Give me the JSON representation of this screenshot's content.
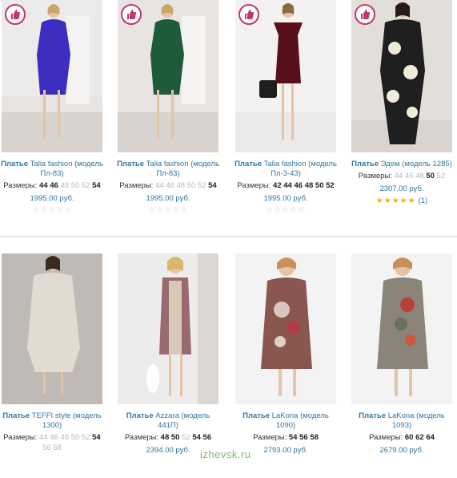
{
  "products": [
    {
      "title_prefix": "Платье",
      "title_rest": "Talia fashion (модель Пл-83)",
      "sizes_label": "Размеры:",
      "sizes": [
        {
          "s": "44",
          "on": true
        },
        {
          "s": "46",
          "on": true
        },
        {
          "s": "48",
          "on": false
        },
        {
          "s": "50",
          "on": false
        },
        {
          "s": "52",
          "on": false
        },
        {
          "s": "54",
          "on": true
        }
      ],
      "price": "1995.00 руб.",
      "rating": "",
      "liked": true
    },
    {
      "title_prefix": "Платье",
      "title_rest": "Talia fashion (модель Пл-83)",
      "sizes_label": "Размеры:",
      "sizes": [
        {
          "s": "44",
          "on": false
        },
        {
          "s": "46",
          "on": false
        },
        {
          "s": "48",
          "on": false
        },
        {
          "s": "50",
          "on": false
        },
        {
          "s": "52",
          "on": false
        },
        {
          "s": "54",
          "on": true
        }
      ],
      "price": "1995.00 руб.",
      "rating": "",
      "liked": true
    },
    {
      "title_prefix": "Платье",
      "title_rest": "Talia fashion (модель Пл-3-43)",
      "sizes_label": "Размеры:",
      "sizes": [
        {
          "s": "42",
          "on": true
        },
        {
          "s": "44",
          "on": true
        },
        {
          "s": "46",
          "on": true
        },
        {
          "s": "48",
          "on": true
        },
        {
          "s": "50",
          "on": true
        },
        {
          "s": "52",
          "on": true
        }
      ],
      "price": "1995.00 руб.",
      "rating": "",
      "liked": true
    },
    {
      "title_prefix": "Платье",
      "title_rest": "Эдем (модель 1285)",
      "sizes_label": "Размеры:",
      "sizes": [
        {
          "s": "44",
          "on": false
        },
        {
          "s": "46",
          "on": false
        },
        {
          "s": "48",
          "on": false
        },
        {
          "s": "50",
          "on": true
        },
        {
          "s": "52",
          "on": false
        }
      ],
      "price": "2307.00 руб.",
      "rating": "(1)",
      "liked": true
    },
    {
      "title_prefix": "Платье",
      "title_rest": "TEFFI style (модель 1300)",
      "sizes_label": "Размеры:",
      "sizes": [
        {
          "s": "44",
          "on": false
        },
        {
          "s": "46",
          "on": false
        },
        {
          "s": "48",
          "on": false
        },
        {
          "s": "50",
          "on": false
        },
        {
          "s": "52",
          "on": false
        },
        {
          "s": "54",
          "on": true
        },
        {
          "s": "56",
          "on": false
        },
        {
          "s": "58",
          "on": false
        }
      ],
      "price": "",
      "rating": "",
      "liked": false
    },
    {
      "title_prefix": "Платье",
      "title_rest": "Azzara (модель 441П)",
      "sizes_label": "Размеры:",
      "sizes": [
        {
          "s": "48",
          "on": true
        },
        {
          "s": "50",
          "on": true
        },
        {
          "s": "52",
          "on": false
        },
        {
          "s": "54",
          "on": true
        },
        {
          "s": "56",
          "on": true
        }
      ],
      "price": "2394.00 руб.",
      "rating": "",
      "liked": false
    },
    {
      "title_prefix": "Платье",
      "title_rest": "LaKona (модель 1090)",
      "sizes_label": "Размеры:",
      "sizes": [
        {
          "s": "54",
          "on": true
        },
        {
          "s": "56",
          "on": true
        },
        {
          "s": "58",
          "on": true
        }
      ],
      "price": "2793.00 руб.",
      "rating": "",
      "liked": false
    },
    {
      "title_prefix": "Платье",
      "title_rest": "LaKona (модель 1093)",
      "sizes_label": "Размеры:",
      "sizes": [
        {
          "s": "60",
          "on": true
        },
        {
          "s": "62",
          "on": true
        },
        {
          "s": "64",
          "on": true
        }
      ],
      "price": "2679.00 руб.",
      "rating": "",
      "liked": false
    }
  ],
  "watermark": "izhevsk.ru",
  "colors": {
    "accent": "#2f76a6",
    "like": "#c2386b",
    "star": "#f2b400"
  }
}
